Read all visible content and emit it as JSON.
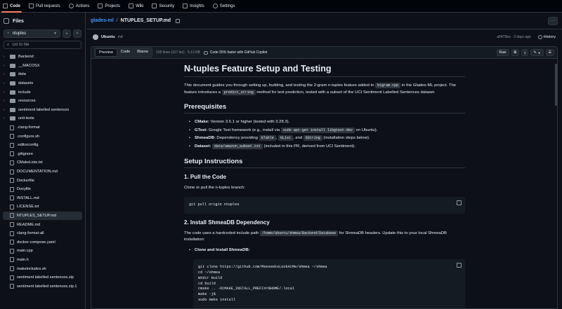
{
  "nav": {
    "tabs": [
      "Code",
      "Pull requests",
      "Actions",
      "Projects",
      "Wiki",
      "Security",
      "Insights",
      "Settings"
    ]
  },
  "sidebar": {
    "title": "Files",
    "branch": "ntuples",
    "search_placeholder": "Go to file",
    "items": [
      {
        "name": "Backend",
        "type": "folder"
      },
      {
        "name": "__MACOSX",
        "type": "folder"
      },
      {
        "name": "data",
        "type": "folder"
      },
      {
        "name": "datasets",
        "type": "folder"
      },
      {
        "name": "include",
        "type": "folder"
      },
      {
        "name": "resources",
        "type": "folder"
      },
      {
        "name": "sentiment labelled sentences",
        "type": "folder"
      },
      {
        "name": "unit-tests",
        "type": "folder"
      },
      {
        "name": ".clang-format",
        "type": "file"
      },
      {
        "name": ".configure.sh",
        "type": "file"
      },
      {
        "name": ".editorconfig",
        "type": "file"
      },
      {
        "name": ".gitignore",
        "type": "file"
      },
      {
        "name": "CMakeLists.txt",
        "type": "file"
      },
      {
        "name": "DOCUMENTATION.md",
        "type": "file"
      },
      {
        "name": "Dockerfile",
        "type": "file"
      },
      {
        "name": "Doxyfile",
        "type": "file"
      },
      {
        "name": "INSTALL.md",
        "type": "file"
      },
      {
        "name": "LICENSE.txt",
        "type": "file"
      },
      {
        "name": "NTUPLES_SETUP.md",
        "type": "file",
        "active": true
      },
      {
        "name": "README.md",
        "type": "file"
      },
      {
        "name": "clang-format-all",
        "type": "file"
      },
      {
        "name": "docker-compose.yaml",
        "type": "file"
      },
      {
        "name": "main.cpp",
        "type": "file"
      },
      {
        "name": "main.h",
        "type": "file"
      },
      {
        "name": "makeincludes.sh",
        "type": "file"
      },
      {
        "name": "sentiment labelled sentences.zip",
        "type": "file"
      },
      {
        "name": "sentiment labelled sentences.zip.1",
        "type": "file"
      }
    ]
  },
  "breadcrumb": {
    "repo": "glades-ml",
    "sep": "/",
    "file": "NTUPLES_SETUP.md"
  },
  "commit": {
    "author": "Ubuntu",
    "message": "md",
    "meta": "a5476bo · 2 days ago",
    "history_label": "History"
  },
  "toolbar": {
    "tabs": [
      "Preview",
      "Code",
      "Blame"
    ],
    "file_info": "135 lines (117 loc) · 5.13 KB",
    "copilot": "Code 55% faster with GitHub Copilot",
    "raw": "Raw"
  },
  "doc": {
    "title": "N-tuples Feature Setup and Testing",
    "intro1": "This document guides you through setting up, building, and testing the 2-gram n-tuples feature added to ",
    "intro_code1": "bigram.cpp",
    "intro2": " in the Glades-ML project. The feature introduces a ",
    "intro_code2": "predict_string",
    "intro3": " method for text prediction, tested with a subset of the UCI Sentiment Labelled Sentences dataset.",
    "prereq_heading": "Prerequisites",
    "prereqs": {
      "cmake_label": "CMake:",
      "cmake_text": " Version 3.5.1 or higher (tested with 3.28.3).",
      "gtest_label": "GTest:",
      "gtest_text1": " Google Test framework (e.g., install via ",
      "gtest_code": "sudo apt-get install libgtest-dev",
      "gtest_text2": " on Ubuntu).",
      "shmea_label": "ShmeaDB:",
      "shmea_text1": " Dependency providing ",
      "shmea_code1": "GTable",
      "shmea_text2": ", ",
      "shmea_code2": "GList",
      "shmea_text3": ", and ",
      "shmea_code3": "GString",
      "shmea_text4": " (installation steps below).",
      "dataset_label": "Dataset:",
      "dataset_code": "data/amazon_subset.txt",
      "dataset_text": " (included in this PR, derived from UCI Sentiment)."
    },
    "setup_heading": "Setup Instructions",
    "step1_heading": "1. Pull the Code",
    "step1_text": "Clone or pull the n-tuples branch:",
    "step1_code": "git pull origin ntuples",
    "step2_heading": "2. Install ShmeaDB Dependency",
    "step2_text1": "The code uses a hardcoded include path ",
    "step2_code": "/home/ubuntu/shmea/Backend/Database",
    "step2_text2": " for ShmeaDB headers. Update this to your local ShmeaDB installation:",
    "step2_bullet": "Clone and Install ShmeaDB:",
    "step2_block": "git clone https://github.com/MeeseeksLookAtMe/shmea ~/shmea\ncd ~/shmea\nmkdir build\ncd build\ncmake .. -DCMAKE_INSTALL_PREFIX=$HOME/.local\nmake -j$\nsudo make install"
  }
}
